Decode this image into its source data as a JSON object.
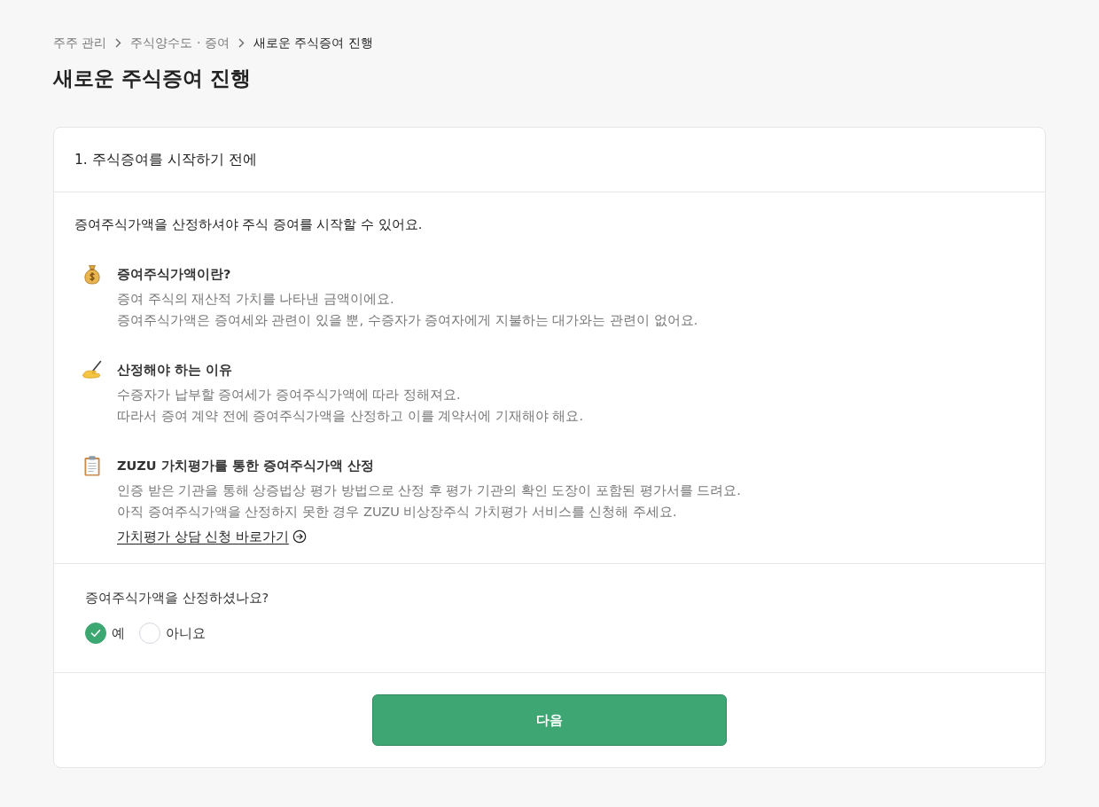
{
  "breadcrumb": [
    {
      "label": "주주 관리",
      "current": false
    },
    {
      "label": "주식양수도 · 증여",
      "current": false
    },
    {
      "label": "새로운 주식증여 진행",
      "current": true
    }
  ],
  "page_title": "새로운 주식증여 진행",
  "card": {
    "step_title": "1. 주식증여를 시작하기 전에",
    "intro": "증여주식가액을 산정하셔야 주식 증여를 시작할 수 있어요.",
    "info_items": [
      {
        "title": "증여주식가액이란?",
        "lines": [
          "증여 주식의 재산적 가치를 나타낸 금액이에요.",
          "증여주식가액은 증여세와 관련이 있을 뿐, 수증자가 증여자에게 지불하는 대가와는 관련이 없어요."
        ]
      },
      {
        "title": "산정해야 하는 이유",
        "lines": [
          "수증자가 납부할 증여세가 증여주식가액에 따라 정해져요.",
          "따라서 증여 계약 전에 증여주식가액을 산정하고 이를 계약서에 기재해야 해요."
        ]
      },
      {
        "title": "ZUZU 가치평가를 통한 증여주식가액 산정",
        "lines": [
          "인증 받은 기관을 통해 상증법상 평가 방법으로 산정 후 평가 기관의 확인 도장이 포함된 평가서를 드려요.",
          "아직 증여주식가액을 산정하지 못한 경우 ZUZU 비상장주식 가치평가 서비스를 신청해 주세요."
        ],
        "link": "가치평가 상담 신청 바로가기"
      }
    ],
    "question": {
      "text": "증여주식가액을 산정하셨나요?",
      "options": [
        {
          "label": "예",
          "selected": true
        },
        {
          "label": "아니요",
          "selected": false
        }
      ]
    },
    "next_button": "다음"
  }
}
